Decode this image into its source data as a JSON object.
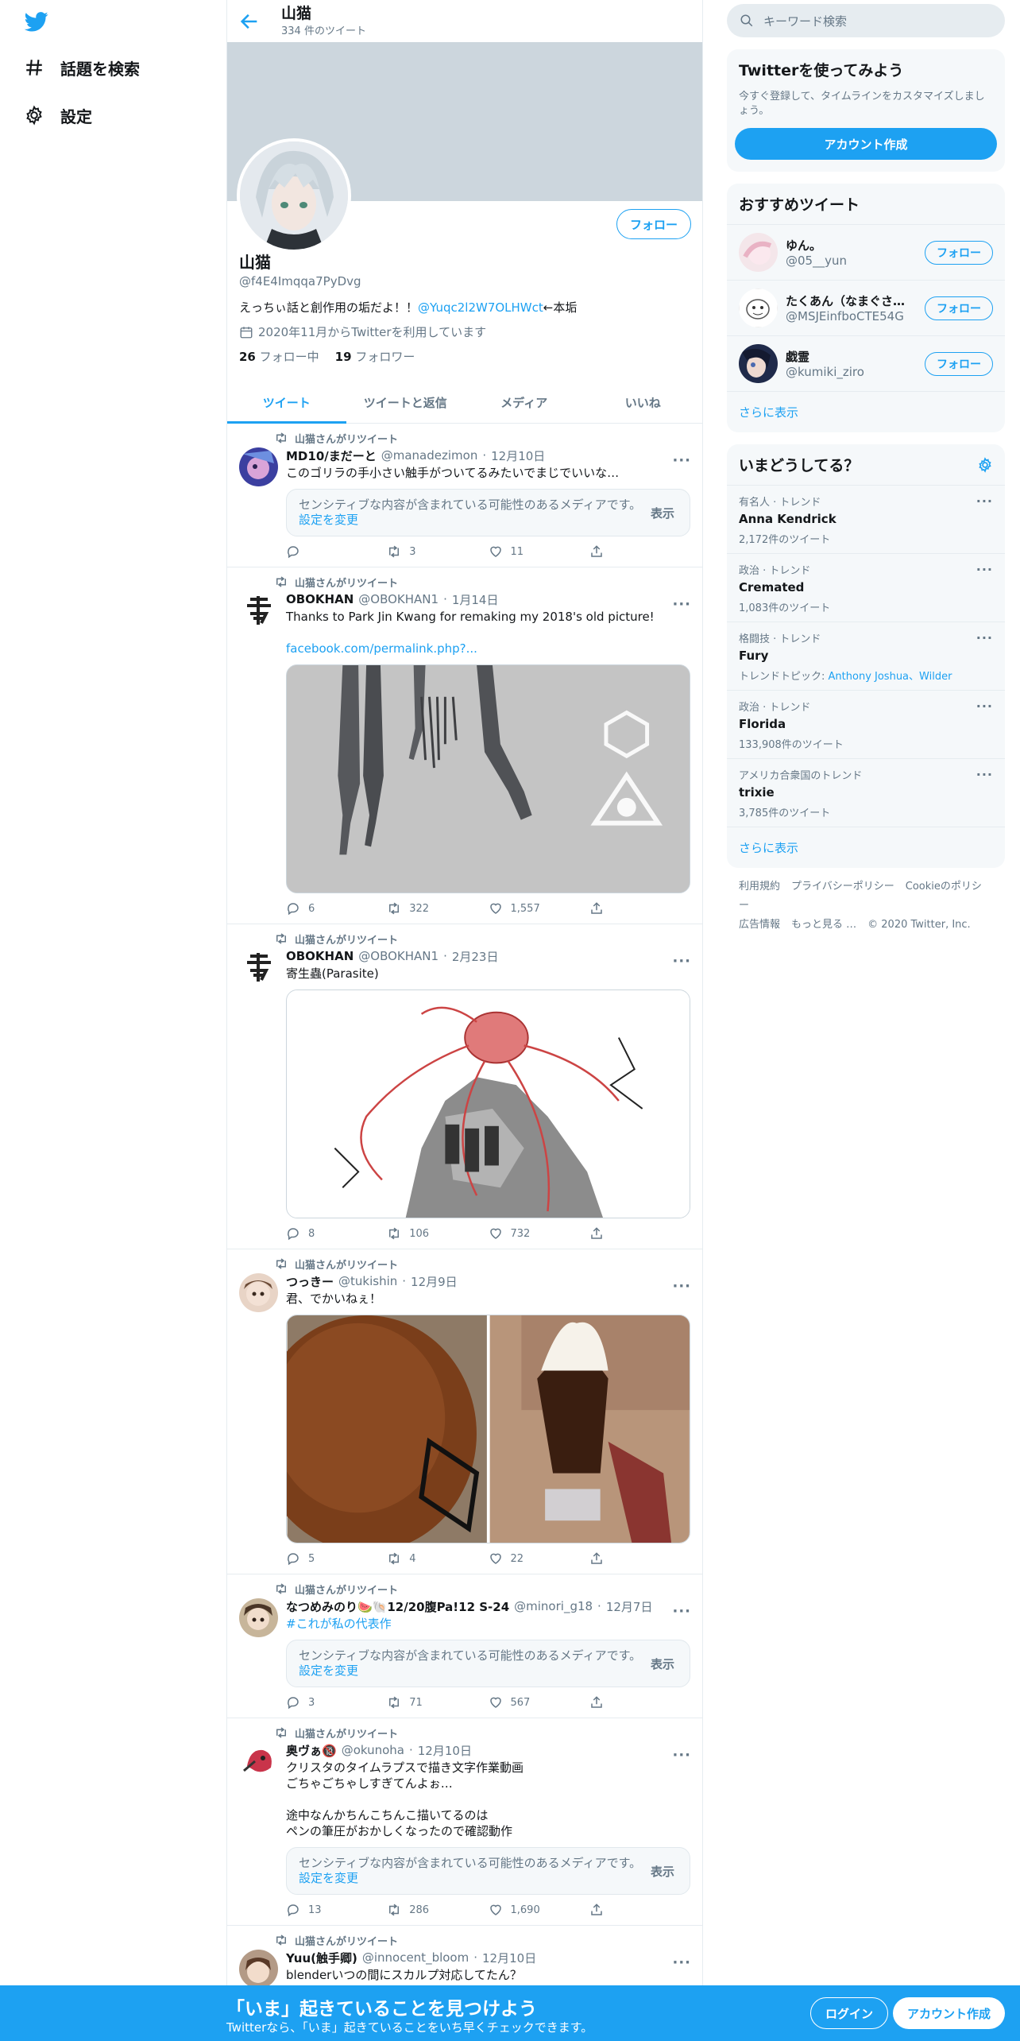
{
  "nav": {
    "explore_label": "話題を検索",
    "settings_label": "設定"
  },
  "profile": {
    "header_name": "山猫",
    "tweet_count": "334 件のツイート",
    "name": "山猫",
    "handle": "@f4E4Imqqa7PyDvg",
    "bio_text": "えっちぃ話と創作用の垢だよ！！",
    "bio_mention": "@Yuqc2l2W7OLHWct",
    "bio_suffix": "←本垢",
    "joined": "2020年11月からTwitterを利用しています",
    "following_count": "26",
    "following_label": "フォロー中",
    "followers_count": "19",
    "followers_label": "フォロワー",
    "follow_button": "フォロー"
  },
  "tabs": [
    "ツイート",
    "ツイートと返信",
    "メディア",
    "いいね"
  ],
  "sensitive": {
    "text": "センシティブな内容が含まれている可能性のあるメディアです。",
    "link": "設定を変更",
    "show": "表示"
  },
  "tweets": [
    {
      "retweeted_by": "山猫さんがリツイート",
      "name": "MD10/まだーと",
      "handle": "@manadezimon",
      "date": "12月10日",
      "text": "このゴリラの手小さい触手がついてるみたいでまじでいいな…",
      "replies": "",
      "retweets": "3",
      "likes": "11"
    },
    {
      "retweeted_by": "山猫さんがリツイート",
      "name": "OBOKHAN",
      "handle": "@OBOKHAN1",
      "date": "1月14日",
      "text": "Thanks to Park Jin Kwang for remaking my 2018's old picture!",
      "link": "facebook.com/permalink.php?...",
      "replies": "6",
      "retweets": "322",
      "likes": "1,557"
    },
    {
      "retweeted_by": "山猫さんがリツイート",
      "name": "OBOKHAN",
      "handle": "@OBOKHAN1",
      "date": "2月23日",
      "text": "寄生蟲(Parasite)",
      "replies": "8",
      "retweets": "106",
      "likes": "732"
    },
    {
      "retweeted_by": "山猫さんがリツイート",
      "name": "つっきー",
      "handle": "@tukishin",
      "date": "12月9日",
      "text": "君、でかいねぇ！",
      "replies": "5",
      "retweets": "4",
      "likes": "22"
    },
    {
      "retweeted_by": "山猫さんがリツイート",
      "name": "なつめみのり🍉🐚12/20腹Pa!12 S-24",
      "handle": "@minori_g18",
      "date": "12月7日",
      "hashtag": "#これが私の代表作",
      "replies": "3",
      "retweets": "71",
      "likes": "567"
    },
    {
      "retweeted_by": "山猫さんがリツイート",
      "name": "奥ヴぁ🔞",
      "handle": "@okunoha",
      "date": "12月10日",
      "text": "クリスタのタイムラプスで描き文字作業動画\nごちゃごちゃしすぎてんよぉ…\n\n途中なんかちんこちんこ描いてるのは\nペンの筆圧がおかしくなったので確認動作",
      "replies": "13",
      "retweets": "286",
      "likes": "1,690"
    },
    {
      "retweeted_by": "山猫さんがリツイート",
      "name": "Yuu(触手卿)",
      "handle": "@innocent_bloom",
      "date": "12月10日",
      "text": "blenderいつの間にスカルプ対応してたん？"
    }
  ],
  "sidebar": {
    "search_placeholder": "キーワード検索",
    "signup_title": "Twitterを使ってみよう",
    "signup_sub": "今すぐ登録して、タイムラインをカスタマイズしましょう。",
    "signup_button": "アカウント作成",
    "reco_title": "おすすめツイート",
    "reco_users": [
      {
        "name": "ゆん。",
        "handle": "@05__yun",
        "button": "フォロー"
      },
      {
        "name": "たくあん（なまぐさ…",
        "handle": "@MSJEinfboCTE54G",
        "button": "フォロー"
      },
      {
        "name": "戯霊",
        "handle": "@kumiki_ziro",
        "button": "フォロー"
      }
    ],
    "show_more": "さらに表示",
    "trends_title": "いまどうしてる？",
    "trends": [
      {
        "context": "有名人 · トレンド",
        "name": "Anna Kendrick",
        "count": "2,172件のツイート"
      },
      {
        "context": "政治 · トレンド",
        "name": "Cremated",
        "count": "1,083件のツイート"
      },
      {
        "context": "格闘技 · トレンド",
        "name": "Fury",
        "topics_label": "トレンドトピック:",
        "topics": "Anthony Joshua、Wilder"
      },
      {
        "context": "政治 · トレンド",
        "name": "Florida",
        "count": "133,908件のツイート"
      },
      {
        "context": "アメリカ合衆国のトレンド",
        "name": "trixie",
        "count": "3,785件のツイート"
      }
    ],
    "trends_show_more": "さらに表示",
    "footer": [
      "利用規約",
      "プライバシーポリシー",
      "Cookieのポリシー",
      "広告情報",
      "もっと見る …",
      "© 2020 Twitter, Inc."
    ]
  },
  "bottom_bar": {
    "title": "「いま」起きていることを見つけよう",
    "subtitle": "Twitterなら、「いま」起きていることをいち早くチェックできます。",
    "login": "ログイン",
    "signup": "アカウント作成"
  },
  "colors": {
    "accent": "#1da1f2",
    "banner": "#ccd6dd",
    "secondary_text": "#657786"
  },
  "icons": [
    "twitter-logo-icon",
    "hashtag-icon",
    "gear-icon",
    "back-arrow-icon",
    "calendar-icon",
    "retweet-icon",
    "reply-icon",
    "like-icon",
    "share-icon",
    "search-icon",
    "more-icon"
  ]
}
